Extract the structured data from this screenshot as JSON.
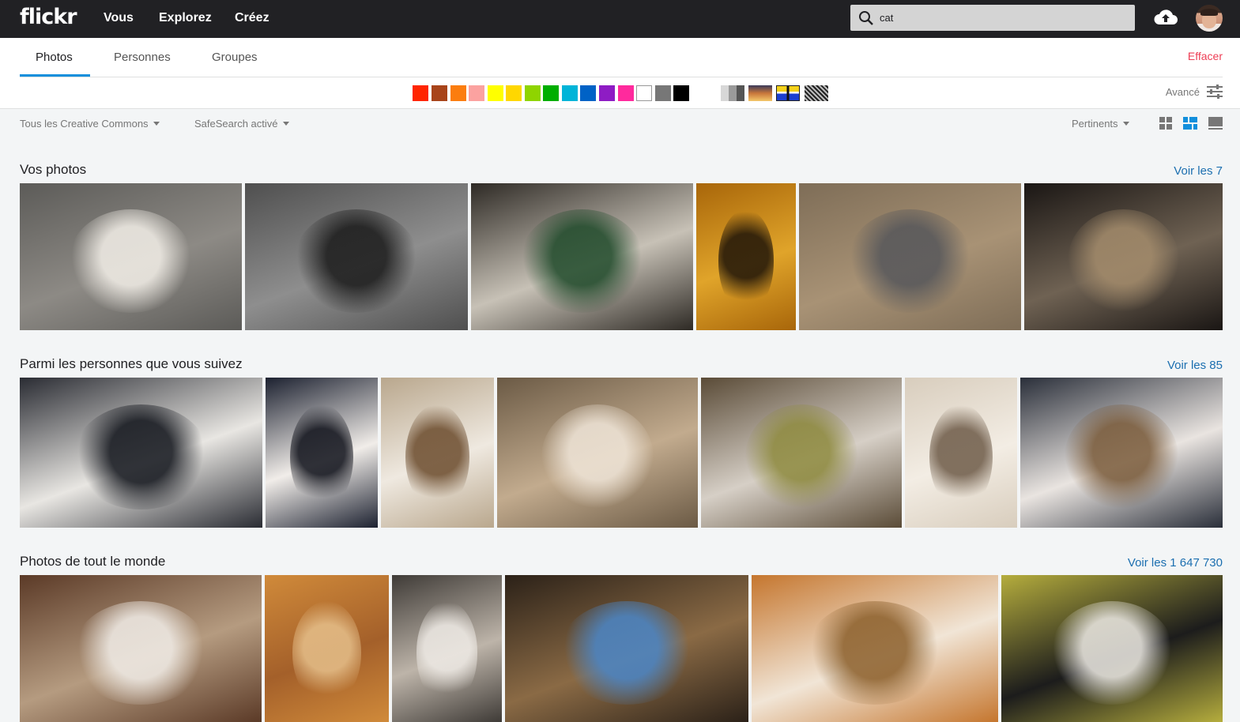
{
  "nav": {
    "logo": "flickr",
    "links": [
      "Vous",
      "Explorez",
      "Créez"
    ],
    "search_value": "cat",
    "search_icon": "search-icon",
    "upload_icon": "cloud-upload-icon",
    "avatar_icon": "user-avatar"
  },
  "tabs": {
    "items": [
      "Photos",
      "Personnes",
      "Groupes"
    ],
    "active": "Photos",
    "clear_label": "Effacer"
  },
  "colors": [
    "#ff2500",
    "#a8441a",
    "#fb7d0f",
    "#fba2a0",
    "#ffff00",
    "#ffd700",
    "#8fd400",
    "#00ae00",
    "#00b4d8",
    "#0062c6",
    "#8e1cc4",
    "#ff2a9d",
    "#ffffff",
    "#777777",
    "#000000"
  ],
  "patterns": [
    "black-and-white",
    "shallow-depth-of-field",
    "minimalist",
    "patterns"
  ],
  "advanced": {
    "label": "Avancé",
    "icon": "sliders-icon"
  },
  "filters": {
    "license": "Tous les Creative Commons",
    "safesearch": "SafeSearch activé",
    "sort": "Pertinents",
    "views": [
      "grid-small-icon",
      "grid-justified-icon",
      "single-view-icon"
    ],
    "active_view": "grid-justified-icon"
  },
  "sections": [
    {
      "title": "Vos photos",
      "see_all": "Voir les 7",
      "photos": [
        {
          "alt": "white cat playing",
          "colors": [
            "#5c5b58",
            "#8d8a85",
            "#f3efe8"
          ]
        },
        {
          "alt": "black and white cat and dog",
          "colors": [
            "#4f4f4f",
            "#8e8e8e",
            "#1a1a1a"
          ]
        },
        {
          "alt": "cat with poker chips",
          "colors": [
            "#2e2a25",
            "#c7c1b6",
            "#1f4a2a"
          ]
        },
        {
          "alt": "cat statues",
          "colors": [
            "#a8660a",
            "#e0a42a",
            "#1c1208"
          ]
        },
        {
          "alt": "tabby cat on stone wall",
          "colors": [
            "#7e6d57",
            "#a89275",
            "#55565a"
          ]
        },
        {
          "alt": "tabby cat portrait",
          "colors": [
            "#1a1614",
            "#6f6253",
            "#a48c6c"
          ]
        }
      ]
    },
    {
      "title": "Parmi les personnes que vous suivez",
      "see_all": "Voir les 85",
      "photos": [
        {
          "alt": "black and white cat lying",
          "colors": [
            "#2a2c33",
            "#e8e6e2",
            "#10131a"
          ]
        },
        {
          "alt": "black and white cat portrait",
          "colors": [
            "#1c2130",
            "#f1ede9",
            "#0d0f18"
          ]
        },
        {
          "alt": "tabby white cat on desk",
          "colors": [
            "#b9a78d",
            "#efe9e0",
            "#6b4b2c"
          ]
        },
        {
          "alt": "tabby cat face",
          "colors": [
            "#6b5a45",
            "#c2ab8e",
            "#efe5d8"
          ]
        },
        {
          "alt": "cat eye close up",
          "colors": [
            "#5a4b37",
            "#d6cfc6",
            "#8e8a3e"
          ]
        },
        {
          "alt": "tabby cat on sofa",
          "colors": [
            "#d8cdbd",
            "#f3ede4",
            "#6d5a47"
          ]
        },
        {
          "alt": "black and white cat looking up",
          "colors": [
            "#2a2f3a",
            "#e9e4e0",
            "#7a5b3a"
          ]
        }
      ]
    },
    {
      "title": "Photos de tout le monde",
      "see_all": "Voir les 1 647 730",
      "photos": [
        {
          "alt": "long hair tabby cat",
          "colors": [
            "#5b3a27",
            "#b59b80",
            "#f1ede8"
          ]
        },
        {
          "alt": "orange cat reaching",
          "colors": [
            "#d08a3a",
            "#a4602a",
            "#e6c08b"
          ]
        },
        {
          "alt": "tabby white cat",
          "colors": [
            "#3f3b37",
            "#bdb4a9",
            "#efebe6"
          ]
        },
        {
          "alt": "tabby cat bokeh",
          "colors": [
            "#2b2118",
            "#8a6a45",
            "#4a86c8"
          ]
        },
        {
          "alt": "orange white cat face",
          "colors": [
            "#c5762e",
            "#f1e5d6",
            "#8b5f2b"
          ]
        },
        {
          "alt": "black white cat outdoors",
          "colors": [
            "#b5ad3d",
            "#1c1c1c",
            "#efece6"
          ]
        }
      ]
    }
  ]
}
